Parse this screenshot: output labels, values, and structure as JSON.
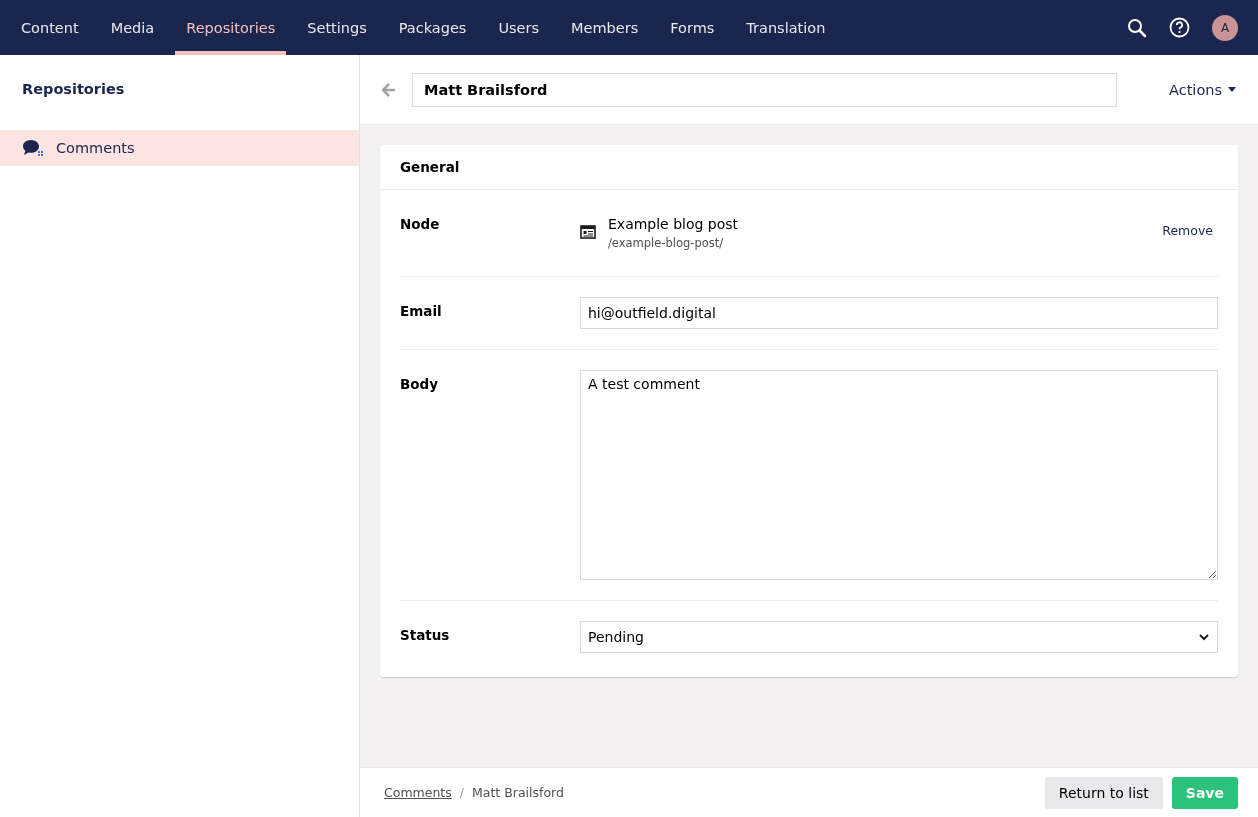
{
  "top_nav": {
    "sections": [
      {
        "label": "Content",
        "selected": false
      },
      {
        "label": "Media",
        "selected": false
      },
      {
        "label": "Repositories",
        "selected": true
      },
      {
        "label": "Settings",
        "selected": false
      },
      {
        "label": "Packages",
        "selected": false
      },
      {
        "label": "Users",
        "selected": false
      },
      {
        "label": "Members",
        "selected": false
      },
      {
        "label": "Forms",
        "selected": false
      },
      {
        "label": "Translation",
        "selected": false
      }
    ],
    "avatar": "A"
  },
  "sidebar": {
    "title": "Repositories",
    "items": [
      {
        "label": "Comments",
        "selected": true
      }
    ]
  },
  "editor": {
    "name": "Matt Brailsford",
    "actions": "Actions"
  },
  "card": {
    "title": "General",
    "fields": [
      {
        "kind": "node",
        "label": "Node",
        "title": "Example blog post",
        "path": "/example-blog-post/",
        "action": "Remove"
      },
      {
        "kind": "text",
        "label": "Email",
        "value": "hi@outfield.digital"
      },
      {
        "kind": "textarea",
        "label": "Body",
        "value": "A test comment"
      },
      {
        "kind": "select",
        "label": "Status",
        "value": "Pending"
      }
    ]
  },
  "footer": {
    "separator": "/",
    "breadcrumb": [
      {
        "label": "Comments",
        "link": true
      },
      {
        "label": "Matt Brailsford",
        "link": false
      }
    ],
    "buttons": [
      {
        "label": "Return to list",
        "kind": "secondary"
      },
      {
        "label": "Save",
        "kind": "primary"
      }
    ]
  }
}
